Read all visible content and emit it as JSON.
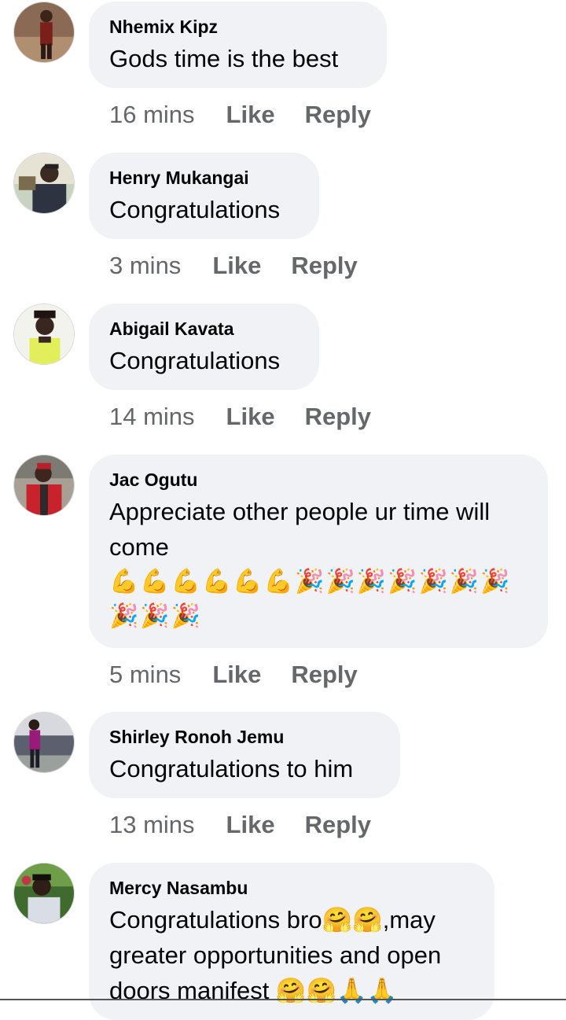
{
  "comments": [
    {
      "author": "Nhemix Kipz",
      "text": "Gods time is the best",
      "emoji": "",
      "time": "16 mins"
    },
    {
      "author": "Henry Mukangai",
      "text": "Congratulations",
      "emoji": "",
      "time": "3 mins"
    },
    {
      "author": "Abigail Kavata",
      "text": "Congratulations",
      "emoji": "",
      "time": "14 mins"
    },
    {
      "author": "Jac Ogutu",
      "text": "Appreciate other people ur time will come",
      "emoji": "💪💪💪💪💪💪🎉🎉🎉🎉🎉🎉🎉🎉🎉🎉",
      "time": "5 mins"
    },
    {
      "author": "Shirley Ronoh Jemu",
      "text": "Congratulations to him",
      "emoji": "",
      "time": "13 mins"
    },
    {
      "author": "Mercy Nasambu",
      "text": "Congratulations bro🤗🤗,may greater opportunities and open doors manifest 🤗🤗🙏🙏",
      "emoji": "",
      "time": ""
    }
  ],
  "actions": {
    "like": "Like",
    "reply": "Reply"
  },
  "colors": {
    "bubble": "#f0f2f5",
    "meta": "#65676b",
    "text": "#050505"
  }
}
